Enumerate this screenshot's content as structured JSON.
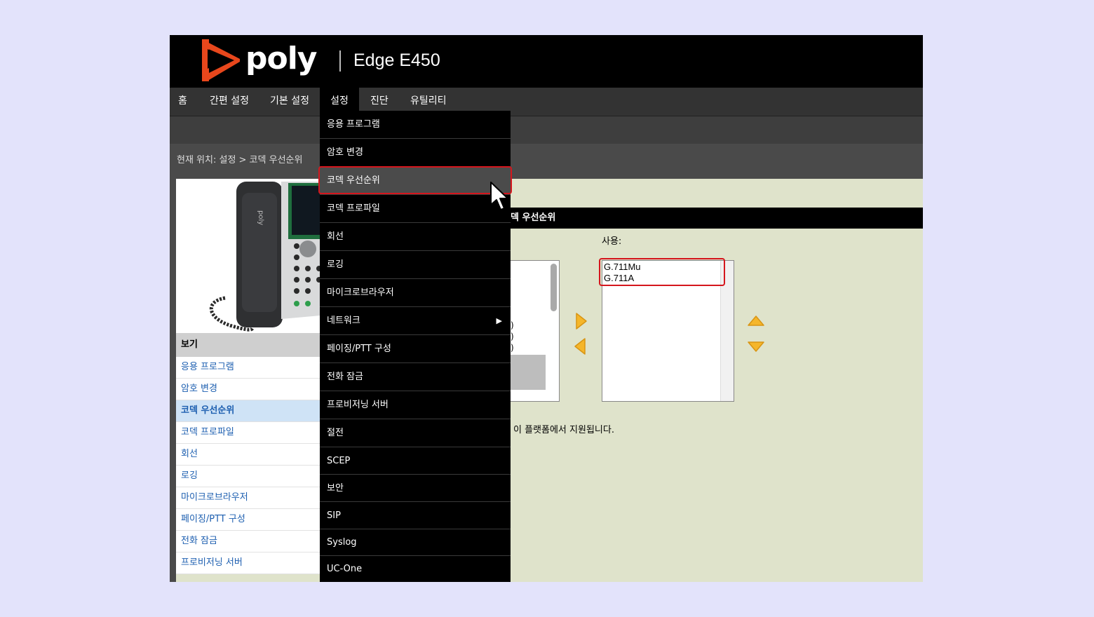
{
  "header": {
    "logo_text": "poly",
    "product": "Edge E450"
  },
  "nav": [
    {
      "label": "홈"
    },
    {
      "label": "간편 설정"
    },
    {
      "label": "기본 설정"
    },
    {
      "label": "설정",
      "active": true
    },
    {
      "label": "진단"
    },
    {
      "label": "유틸리티"
    }
  ],
  "breadcrumb": "현재 위치: 설정 > 코덱 우선순위",
  "sidebar": {
    "heading": "보기",
    "items": [
      {
        "label": "응용 프로그램"
      },
      {
        "label": "암호 변경"
      },
      {
        "label": "코덱 우선순위",
        "selected": true
      },
      {
        "label": "코덱 프로파일"
      },
      {
        "label": "회선"
      },
      {
        "label": "로깅"
      },
      {
        "label": "마이크로브라우저"
      },
      {
        "label": "페이징/PTT 구성"
      },
      {
        "label": "전화 잠금"
      },
      {
        "label": "프로비저닝 서버"
      }
    ]
  },
  "dropdown": {
    "items": [
      {
        "label": "응용 프로그램"
      },
      {
        "label": "암호 변경"
      },
      {
        "label": "코덱 우선순위",
        "highlighted": true
      },
      {
        "label": "코덱 프로파일"
      },
      {
        "label": "회선"
      },
      {
        "label": "로깅"
      },
      {
        "label": "마이크로브라우저"
      },
      {
        "label": "네트워크",
        "submenu": true
      },
      {
        "label": "페이징/PTT 구성"
      },
      {
        "label": "전화 잠금"
      },
      {
        "label": "프로비저닝 서버"
      },
      {
        "label": "절전"
      },
      {
        "label": "SCEP"
      },
      {
        "label": "보안"
      },
      {
        "label": "SIP"
      },
      {
        "label": "Syslog"
      },
      {
        "label": "UC-One"
      }
    ]
  },
  "panel": {
    "title": "덱 우선순위",
    "enabled_label": "사용:",
    "enabled_codecs": [
      "G.711Mu",
      "G.711A"
    ],
    "disabled_fragments": [
      ")",
      ")",
      ")"
    ],
    "note": "이 플랫폼에서 지원됩니다."
  },
  "colors": {
    "accent": "#e8471c",
    "highlight_border": "#d5161d",
    "arrow": "#f5b62b",
    "link": "#1d5fb0"
  }
}
